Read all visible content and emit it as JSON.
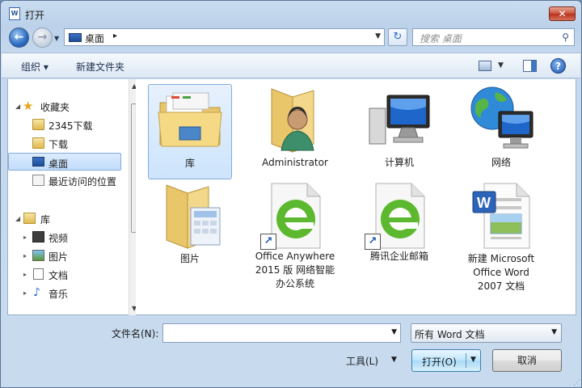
{
  "window": {
    "title": "打开",
    "app_icon_letter": "W",
    "close_glyph": "✕"
  },
  "nav": {
    "back_glyph": "←",
    "forward_glyph": "→",
    "recent_glyph": "▼"
  },
  "address": {
    "location": "桌面",
    "separator": "▸",
    "dropdown": "▼"
  },
  "refresh_glyph": "↻",
  "search": {
    "placeholder": "搜索 桌面",
    "icon_glyph": "⚲"
  },
  "toolbar": {
    "organize_label": "组织 ▾",
    "new_folder_label": "新建文件夹",
    "view_dropdown": "▼",
    "help_glyph": "?"
  },
  "sidebar": {
    "favorites": {
      "label": "收藏夹"
    },
    "fav_items": [
      {
        "label": "2345下载"
      },
      {
        "label": "下载"
      },
      {
        "label": "桌面"
      },
      {
        "label": "最近访问的位置"
      }
    ],
    "library": {
      "label": "库"
    },
    "lib_items": [
      {
        "label": "视频"
      },
      {
        "label": "图片"
      },
      {
        "label": "文档"
      },
      {
        "label": "音乐"
      }
    ],
    "expand_glyph": "▸",
    "collapse_glyph": "◢",
    "scroll_up": "▲",
    "scroll_down": "▼"
  },
  "content": {
    "items": [
      {
        "label": "库",
        "icon": "library-folder-icon"
      },
      {
        "label": "Administrator",
        "icon": "user-folder-icon"
      },
      {
        "label": "计算机",
        "icon": "computer-icon"
      },
      {
        "label": "网络",
        "icon": "network-icon"
      },
      {
        "label": "图片",
        "icon": "pictures-folder-icon"
      },
      {
        "label": "Office Anywhere 2015 版 网络智能办公系统",
        "icon": "ie-shortcut-icon"
      },
      {
        "label": "腾讯企业邮箱",
        "icon": "ie-shortcut-icon"
      },
      {
        "label": "新建 Microsoft Office Word 2007 文档",
        "icon": "word-document-icon"
      }
    ],
    "shortcut_glyph": "↗",
    "ie_glyph": "e",
    "word_glyph": "W"
  },
  "bottom": {
    "filename_label": "文件名(N):",
    "filename_value": "",
    "filetype": "所有 Word 文档",
    "tools_label": "工具(L)",
    "open_label": "打开(O)",
    "cancel_label": "取消",
    "dropdown": "▼",
    "grip": "⋰"
  },
  "colors": {
    "window_frame": "#c7daee",
    "selection": "#cde4fc",
    "close": "#c9503a"
  }
}
